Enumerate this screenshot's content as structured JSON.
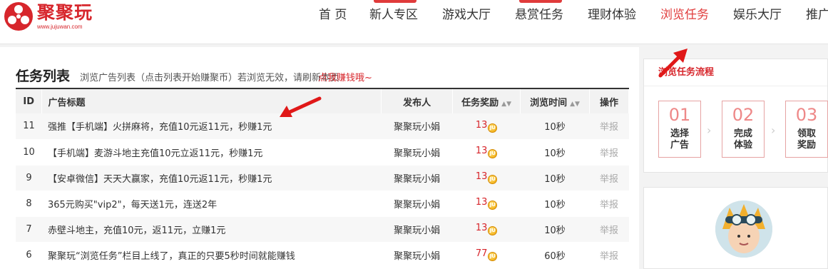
{
  "header": {
    "logo_name": "聚聚玩",
    "logo_url": "www.jujuwan.com",
    "nav": [
      {
        "label": "首 页",
        "active": false,
        "flag": false
      },
      {
        "label": "新人专区",
        "active": false,
        "flag": true
      },
      {
        "label": "游戏大厅",
        "active": false,
        "flag": false
      },
      {
        "label": "悬赏任务",
        "active": false,
        "flag": true
      },
      {
        "label": "理财体验",
        "active": false,
        "flag": false
      },
      {
        "label": "浏览任务",
        "active": true,
        "flag": false
      },
      {
        "label": "娱乐大厅",
        "active": false,
        "flag": false
      },
      {
        "label": "推广",
        "active": false,
        "flag": false
      }
    ]
  },
  "main": {
    "title": "任务列表",
    "subtitle": "浏览广告列表（点击列表开始赚聚币）若浏览无效，请刷新本页",
    "hint": "点我赚钱哦~",
    "columns": {
      "id": "ID",
      "title": "广告标题",
      "publisher": "发布人",
      "reward": "任务奖励",
      "time": "浏览时间",
      "op": "操作"
    },
    "coin_glyph": "JU",
    "rows": [
      {
        "id": "11",
        "title": "强推【手机端】火拼麻将，充值10元返11元，秒赚1元",
        "publisher": "聚聚玩小娟",
        "reward": "13",
        "time": "10秒",
        "op": "举报"
      },
      {
        "id": "10",
        "title": "【手机端】麦游斗地主充值10元立返11元，秒赚1元",
        "publisher": "聚聚玩小娟",
        "reward": "13",
        "time": "10秒",
        "op": "举报"
      },
      {
        "id": "9",
        "title": "【安卓微信】天天大赢家，充值10元返11元，秒赚1元",
        "publisher": "聚聚玩小娟",
        "reward": "13",
        "time": "10秒",
        "op": "举报"
      },
      {
        "id": "8",
        "title": "365元购买\"vip2\"，每天送1元，连送2年",
        "publisher": "聚聚玩小娟",
        "reward": "13",
        "time": "10秒",
        "op": "举报"
      },
      {
        "id": "7",
        "title": "赤壁斗地主，充值10元，返11元，立赚1元",
        "publisher": "聚聚玩小娟",
        "reward": "13",
        "time": "10秒",
        "op": "举报"
      },
      {
        "id": "6",
        "title": "聚聚玩“浏览任务”栏目上线了，真正的只要5秒时间就能赚钱",
        "publisher": "聚聚玩小娟",
        "reward": "77",
        "time": "60秒",
        "op": "举报"
      }
    ]
  },
  "side": {
    "flow_title": "浏览任务流程",
    "steps": [
      {
        "num": "01",
        "label": "选择广告"
      },
      {
        "num": "02",
        "label": "完成体验"
      },
      {
        "num": "03",
        "label": "领取奖励"
      }
    ]
  },
  "colors": {
    "brand": "#d7262c",
    "accent": "#e03b3b"
  }
}
